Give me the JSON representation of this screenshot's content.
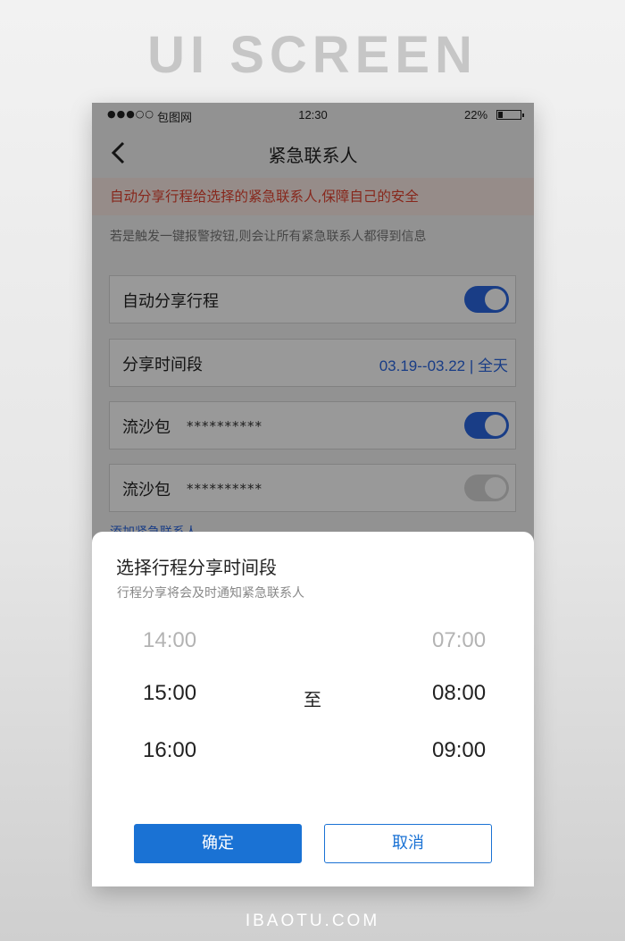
{
  "banner": {
    "title": "UI SCREEN",
    "footer": "IBAOTU.COM"
  },
  "status_bar": {
    "signal_dots": "●●●○○",
    "carrier": "包图网",
    "time": "12:30",
    "battery": "22%"
  },
  "nav": {
    "title": "紧急联系人",
    "back_icon": "chevron-left-icon"
  },
  "warning": "自动分享行程给选择的紧急联系人,保障自己的安全",
  "hint": "若是触发一键报警按钮,则会让所有紧急联系人都得到信息",
  "rows": {
    "auto_share": {
      "label": "自动分享行程",
      "toggle_on": true
    },
    "share_period": {
      "label": "分享时间段",
      "value": "03.19--03.22 | 全天"
    },
    "contact1": {
      "label": "流沙包",
      "mask": "**********",
      "toggle_on": true
    },
    "contact2": {
      "label": "流沙包",
      "mask": "**********",
      "toggle_on": false
    }
  },
  "add_contact": "添加紧急联系人",
  "sheet": {
    "title": "选择行程分享时间段",
    "subtitle": "行程分享将会及时通知紧急联系人",
    "start_times": [
      "14:00",
      "15:00",
      "16:00"
    ],
    "end_times": [
      "07:00",
      "08:00",
      "09:00"
    ],
    "to_label": "至",
    "confirm": "确定",
    "cancel": "取消"
  },
  "colors": {
    "accent": "#1a72d4",
    "toggle_on": "#2b66e0",
    "warning_text": "#e2422f",
    "warning_bg": "#fbe9e4"
  }
}
